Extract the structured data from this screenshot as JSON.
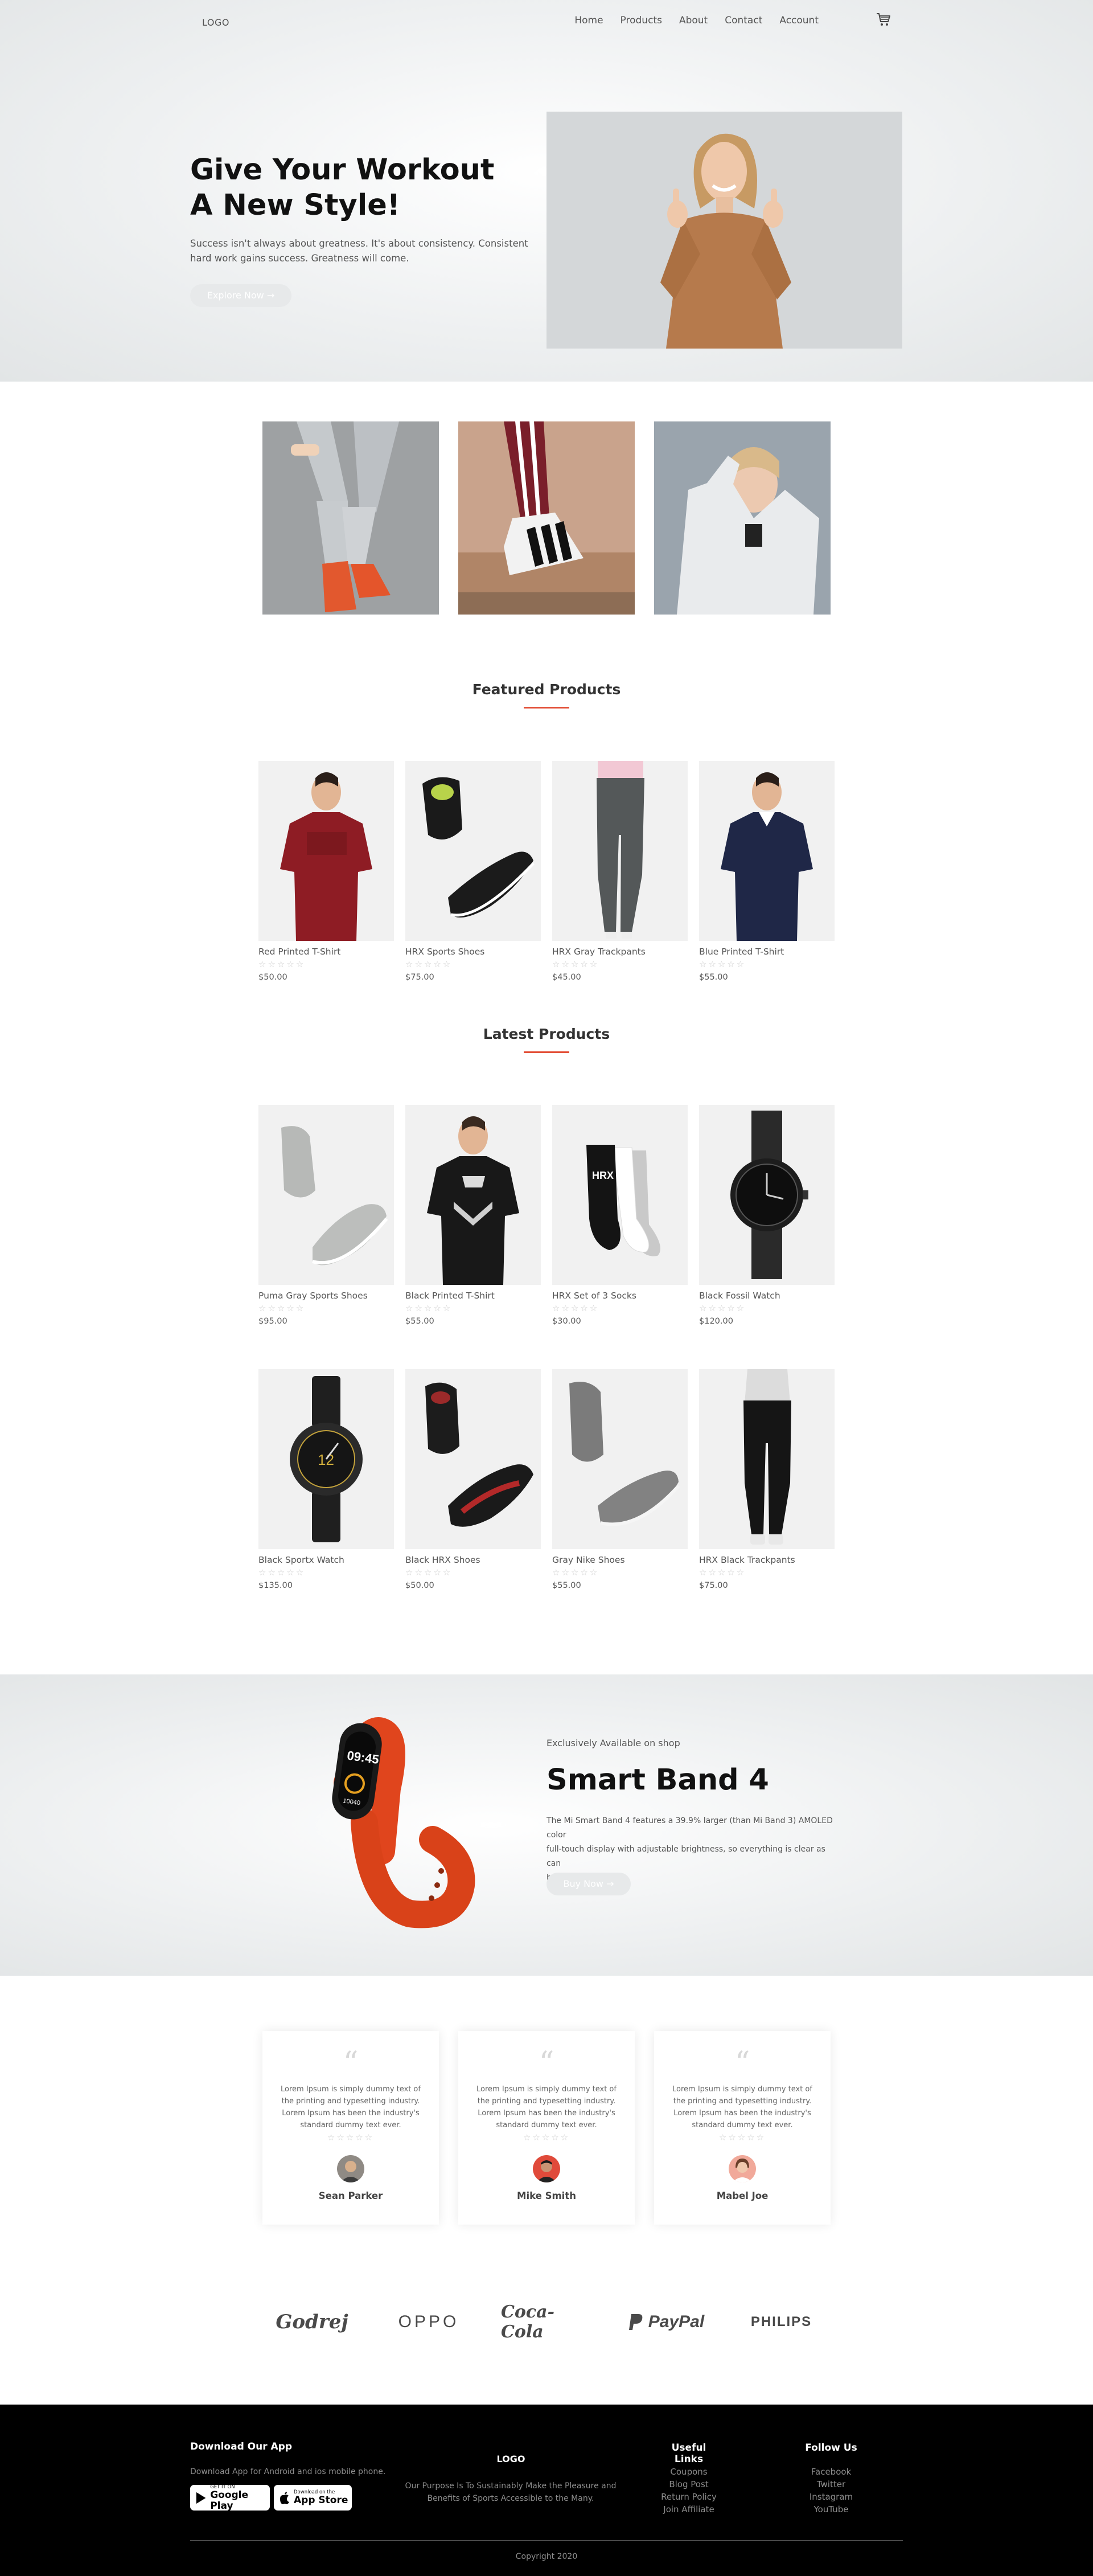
{
  "header": {
    "logo": "LOGO",
    "nav": [
      "Home",
      "Products",
      "About",
      "Contact",
      "Account"
    ],
    "cart_icon": "cart-icon"
  },
  "hero": {
    "title_line1": "Give Your Workout",
    "title_line2": "A New Style!",
    "description_line1": "Success isn't always about greatness. It's about consistency. Consistent",
    "description_line2": "hard work gains success. Greatness will come.",
    "button": "Explore Now →"
  },
  "featured": {
    "title": "Featured Products",
    "products": [
      {
        "name": "Red Printed T-Shirt",
        "price": "$50.00",
        "rating": "☆☆☆☆☆"
      },
      {
        "name": "HRX Sports Shoes",
        "price": "$75.00",
        "rating": "☆☆☆☆☆"
      },
      {
        "name": "HRX Gray Trackpants",
        "price": "$45.00",
        "rating": "☆☆☆☆☆"
      },
      {
        "name": "Blue Printed T-Shirt",
        "price": "$55.00",
        "rating": "☆☆☆☆☆"
      }
    ]
  },
  "latest": {
    "title": "Latest Products",
    "products": [
      {
        "name": "Puma Gray Sports Shoes",
        "price": "$95.00",
        "rating": "☆☆☆☆☆"
      },
      {
        "name": "Black Printed T-Shirt",
        "price": "$55.00",
        "rating": "☆☆☆☆☆"
      },
      {
        "name": "HRX Set of 3 Socks",
        "price": "$30.00",
        "rating": "☆☆☆☆☆"
      },
      {
        "name": "Black Fossil Watch",
        "price": "$120.00",
        "rating": "☆☆☆☆☆"
      },
      {
        "name": "Black Sportx Watch",
        "price": "$135.00",
        "rating": "☆☆☆☆☆"
      },
      {
        "name": "Black HRX Shoes",
        "price": "$50.00",
        "rating": "☆☆☆☆☆"
      },
      {
        "name": "Gray Nike Shoes",
        "price": "$55.00",
        "rating": "☆☆☆☆☆"
      },
      {
        "name": "HRX Black Trackpants",
        "price": "$75.00",
        "rating": "☆☆☆☆☆"
      }
    ]
  },
  "offer": {
    "kicker": "Exclusively Available on shop",
    "title": "Smart Band 4",
    "description_line1": "The Mi Smart Band 4 features a 39.9% larger (than Mi Band 3) AMOLED color",
    "description_line2": "full-touch display with adjustable brightness, so everything is clear as can",
    "description_line3": "be.",
    "button": "Buy Now →",
    "screen_time": "09:45",
    "screen_steps": "10040"
  },
  "testimonials": [
    {
      "text": "Lorem Ipsum is simply dummy text of the printing and typesetting industry. Lorem Ipsum has been the industry's standard dummy text ever.",
      "name": "Sean Parker",
      "rating": "☆☆☆☆☆"
    },
    {
      "text": "Lorem Ipsum is simply dummy text of the printing and typesetting industry. Lorem Ipsum has been the industry's standard dummy text ever.",
      "name": "Mike Smith",
      "rating": "☆☆☆☆☆"
    },
    {
      "text": "Lorem Ipsum is simply dummy text of the printing and typesetting industry. Lorem Ipsum has been the industry's standard dummy text ever.",
      "name": "Mabel Joe",
      "rating": "☆☆☆☆☆"
    }
  ],
  "brands": [
    "Godrej",
    "OPPO",
    "Coca-Cola",
    "PayPal",
    "PHILIPS"
  ],
  "footer": {
    "download_title": "Download Our App",
    "download_text": "Download App for Android and ios mobile phone.",
    "google_play_small": "GET IT ON",
    "google_play_big": "Google Play",
    "app_store_small": "Download on the",
    "app_store_big": "App Store",
    "logo": "LOGO",
    "purpose_line1": "Our Purpose Is To Sustainably Make the Pleasure and",
    "purpose_line2": "Benefits of Sports Accessible to the Many.",
    "useful_links_title": "Useful Links",
    "useful_links": [
      "Coupons",
      "Blog Post",
      "Return Policy",
      "Join Affiliate"
    ],
    "follow_title": "Follow Us",
    "follow_links": [
      "Facebook",
      "Twitter",
      "Instagram",
      "YouTube"
    ],
    "copyright": "Copyright 2020"
  },
  "colors": {
    "accent": "#e34f37",
    "button_bg": "#e7e9ea",
    "footer_bg": "#000000"
  }
}
